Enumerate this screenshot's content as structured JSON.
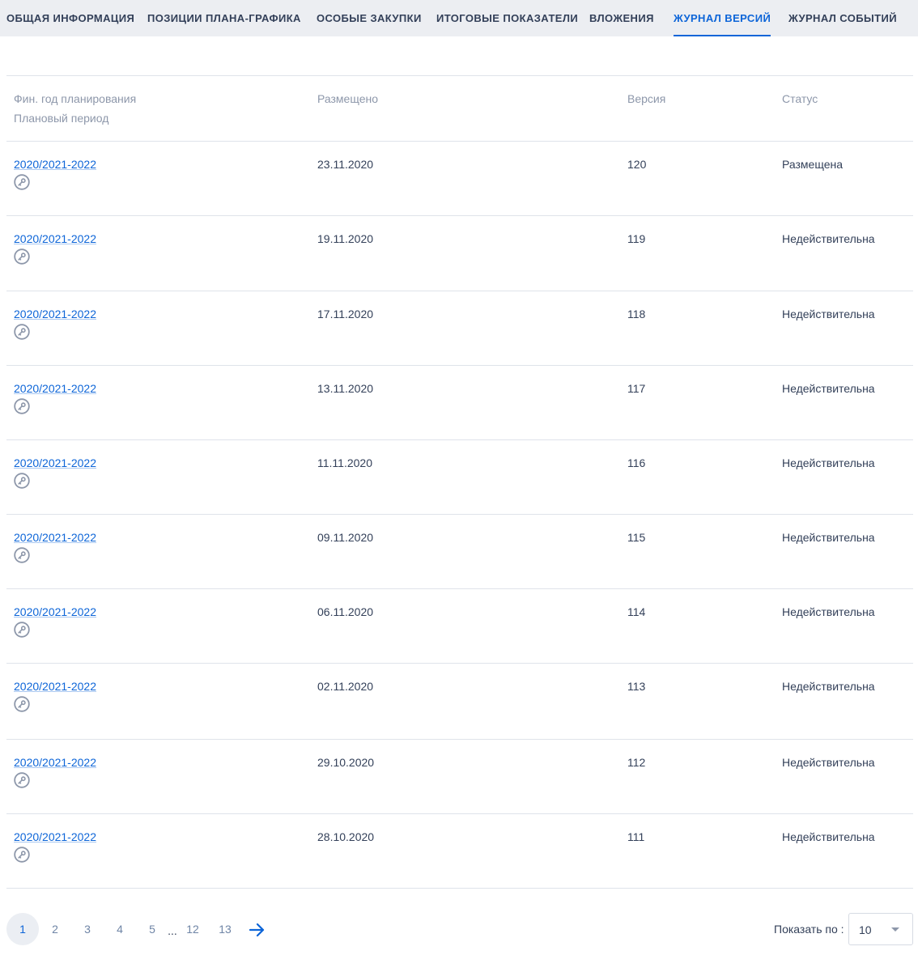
{
  "tabs": [
    {
      "label": "ОБЩАЯ ИНФОРМАЦИЯ",
      "active": false
    },
    {
      "label": "ПОЗИЦИИ ПЛАНА-ГРАФИКА",
      "active": false
    },
    {
      "label": "ОСОБЫЕ ЗАКУПКИ",
      "active": false
    },
    {
      "label": "ИТОГОВЫЕ ПОКАЗАТЕЛИ",
      "active": false
    },
    {
      "label": "ВЛОЖЕНИЯ",
      "active": false
    },
    {
      "label": "ЖУРНАЛ ВЕРСИЙ",
      "active": true
    },
    {
      "label": "ЖУРНАЛ СОБЫТИЙ",
      "active": false
    }
  ],
  "table": {
    "headers": {
      "year_line1": "Фин. год планирования",
      "year_line2": "Плановый период",
      "placed": "Размещено",
      "version": "Версия",
      "status": "Статус"
    },
    "rows": [
      {
        "period": "2020/2021-2022",
        "placed": "23.11.2020",
        "version": "120",
        "status": "Размещена",
        "icon": "signature-key-icon"
      },
      {
        "period": "2020/2021-2022",
        "placed": "19.11.2020",
        "version": "119",
        "status": "Недействительна",
        "icon": "signature-key-icon"
      },
      {
        "period": "2020/2021-2022",
        "placed": "17.11.2020",
        "version": "118",
        "status": "Недействительна",
        "icon": "signature-key-icon"
      },
      {
        "period": "2020/2021-2022",
        "placed": "13.11.2020",
        "version": "117",
        "status": "Недействительна",
        "icon": "signature-key-icon"
      },
      {
        "period": "2020/2021-2022",
        "placed": "11.11.2020",
        "version": "116",
        "status": "Недействительна",
        "icon": "signature-key-icon"
      },
      {
        "period": "2020/2021-2022",
        "placed": "09.11.2020",
        "version": "115",
        "status": "Недействительна",
        "icon": "signature-key-icon"
      },
      {
        "period": "2020/2021-2022",
        "placed": "06.11.2020",
        "version": "114",
        "status": "Недействительна",
        "icon": "signature-key-icon"
      },
      {
        "period": "2020/2021-2022",
        "placed": "02.11.2020",
        "version": "113",
        "status": "Недействительна",
        "icon": "signature-key-icon"
      },
      {
        "period": "2020/2021-2022",
        "placed": "29.10.2020",
        "version": "112",
        "status": "Недействительна",
        "icon": "signature-key-icon"
      },
      {
        "period": "2020/2021-2022",
        "placed": "28.10.2020",
        "version": "111",
        "status": "Недействительна",
        "icon": "signature-key-icon"
      }
    ]
  },
  "pagination": {
    "pages": [
      "1",
      "2",
      "3",
      "4",
      "5"
    ],
    "ellipsis": "...",
    "last_pages": [
      "12",
      "13"
    ],
    "current": "1",
    "next_icon": "arrow-right-icon",
    "show_label": "Показать по :",
    "page_size": "10"
  },
  "colors": {
    "accent": "#0d65d8",
    "text": "#334059",
    "muted": "#8d97aa",
    "tabbar_bg": "#eceef2",
    "divider": "#dfe3ea"
  }
}
